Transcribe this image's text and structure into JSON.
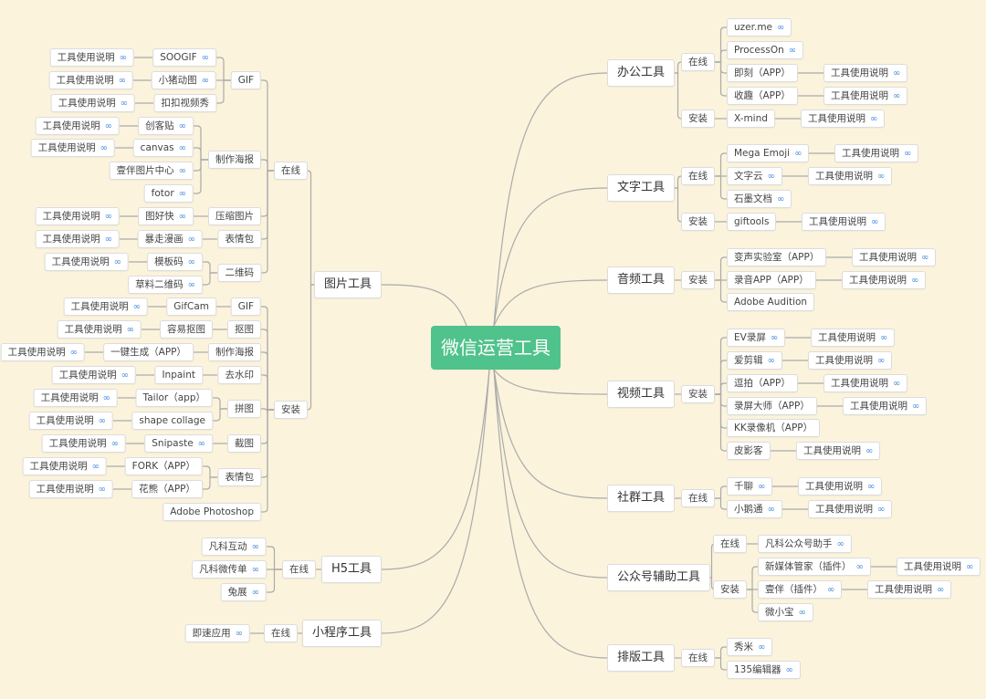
{
  "root": {
    "label": "微信运营工具"
  },
  "colors": {
    "background": "#fbf3dc",
    "root": "#50c28b",
    "link_icon": "#4a90e2",
    "connector": "#aaaaaa"
  },
  "link_icon_glyph": "link-icon",
  "left_branches": [
    {
      "label": "图片工具",
      "groups": [
        {
          "label": "在线",
          "categories": [
            {
              "label": "GIF",
              "items": [
                {
                  "label": "SOOGIF",
                  "link": true,
                  "doc": "工具使用说明"
                },
                {
                  "label": "小猪动图",
                  "link": true,
                  "doc": "工具使用说明"
                },
                {
                  "label": "扣扣视频秀",
                  "link": false,
                  "doc": "工具使用说明"
                }
              ]
            },
            {
              "label": "制作海报",
              "items": [
                {
                  "label": "创客贴",
                  "link": true,
                  "doc": "工具使用说明"
                },
                {
                  "label": "canvas",
                  "link": true,
                  "doc": "工具使用说明"
                },
                {
                  "label": "壹伴图片中心",
                  "link": true
                },
                {
                  "label": "fotor",
                  "link": true
                }
              ]
            },
            {
              "label": "压缩图片",
              "items": [
                {
                  "label": "图好快",
                  "link": true,
                  "doc": "工具使用说明"
                }
              ]
            },
            {
              "label": "表情包",
              "items": [
                {
                  "label": "暴走漫画",
                  "link": true,
                  "doc": "工具使用说明"
                }
              ]
            },
            {
              "label": "二维码",
              "items": [
                {
                  "label": "模板码",
                  "link": true,
                  "doc": "工具使用说明"
                },
                {
                  "label": "草料二维码",
                  "link": true
                }
              ]
            }
          ]
        },
        {
          "label": "安装",
          "categories": [
            {
              "label": "GIF",
              "items": [
                {
                  "label": "GifCam",
                  "link": false,
                  "doc": "工具使用说明"
                }
              ]
            },
            {
              "label": "抠图",
              "items": [
                {
                  "label": "容易抠图",
                  "link": false,
                  "doc": "工具使用说明"
                }
              ]
            },
            {
              "label": "制作海报",
              "items": [
                {
                  "label": "一键生成（APP）",
                  "link": false,
                  "doc": "工具使用说明"
                }
              ]
            },
            {
              "label": "去水印",
              "items": [
                {
                  "label": "Inpaint",
                  "link": false,
                  "doc": "工具使用说明"
                }
              ]
            },
            {
              "label": "拼图",
              "items": [
                {
                  "label": "Tailor（app）",
                  "link": false,
                  "doc": "工具使用说明"
                },
                {
                  "label": "shape collage",
                  "link": false,
                  "doc": "工具使用说明"
                }
              ]
            },
            {
              "label": "截图",
              "items": [
                {
                  "label": "Snipaste",
                  "link": true,
                  "doc": "工具使用说明"
                }
              ]
            },
            {
              "label": "表情包",
              "items": [
                {
                  "label": "FORK（APP）",
                  "link": false,
                  "doc": "工具使用说明"
                },
                {
                  "label": "花熊（APP）",
                  "link": false,
                  "doc": "工具使用说明"
                }
              ]
            },
            {
              "label": "Adobe Photoshop",
              "items": []
            }
          ]
        }
      ]
    },
    {
      "label": "H5工具",
      "groups": [
        {
          "label": "在线",
          "items": [
            {
              "label": "凡科互动",
              "link": true
            },
            {
              "label": "凡科微传单",
              "link": true
            },
            {
              "label": "兔展",
              "link": true
            }
          ]
        }
      ]
    },
    {
      "label": "小程序工具",
      "groups": [
        {
          "label": "在线",
          "items": [
            {
              "label": "即速应用",
              "link": true
            }
          ]
        }
      ]
    }
  ],
  "right_branches": [
    {
      "label": "办公工具",
      "groups": [
        {
          "label": "在线",
          "items": [
            {
              "label": "uzer.me",
              "link": true
            },
            {
              "label": "ProcessOn",
              "link": true
            },
            {
              "label": "即刻（APP）",
              "link": false,
              "doc": "工具使用说明"
            },
            {
              "label": "收趣（APP）",
              "link": false,
              "doc": "工具使用说明"
            }
          ]
        },
        {
          "label": "安装",
          "items": [
            {
              "label": "X-mind",
              "link": false,
              "doc": "工具使用说明"
            }
          ]
        }
      ]
    },
    {
      "label": "文字工具",
      "groups": [
        {
          "label": "在线",
          "items": [
            {
              "label": "Mega Emoji",
              "link": true,
              "doc": "工具使用说明"
            },
            {
              "label": "文字云",
              "link": true,
              "doc": "工具使用说明"
            },
            {
              "label": "石墨文档",
              "link": true
            }
          ]
        },
        {
          "label": "安装",
          "items": [
            {
              "label": "giftools",
              "link": false,
              "doc": "工具使用说明"
            }
          ]
        }
      ]
    },
    {
      "label": "音频工具",
      "groups": [
        {
          "label": "安装",
          "items": [
            {
              "label": "变声实验室（APP）",
              "link": false,
              "doc": "工具使用说明"
            },
            {
              "label": "录音APP（APP）",
              "link": false,
              "doc": "工具使用说明"
            },
            {
              "label": "Adobe Audition",
              "link": false
            }
          ]
        }
      ]
    },
    {
      "label": "视频工具",
      "groups": [
        {
          "label": "安装",
          "items": [
            {
              "label": "EV录屏",
              "link": true,
              "doc": "工具使用说明"
            },
            {
              "label": "爱剪辑",
              "link": true,
              "doc": "工具使用说明"
            },
            {
              "label": "逗拍（APP）",
              "link": false,
              "doc": "工具使用说明"
            },
            {
              "label": "录屏大师（APP）",
              "link": false,
              "doc": "工具使用说明"
            },
            {
              "label": "KK录像机（APP）",
              "link": false
            },
            {
              "label": "皮影客",
              "link": false,
              "doc": "工具使用说明"
            }
          ]
        }
      ]
    },
    {
      "label": "社群工具",
      "groups": [
        {
          "label": "在线",
          "items": [
            {
              "label": "千聊",
              "link": true,
              "doc": "工具使用说明"
            },
            {
              "label": "小鹅通",
              "link": true,
              "doc": "工具使用说明"
            }
          ]
        }
      ]
    },
    {
      "label": "公众号辅助工具",
      "groups": [
        {
          "label": "在线",
          "items": [
            {
              "label": "凡科公众号助手",
              "link": true
            }
          ]
        },
        {
          "label": "安装",
          "items": [
            {
              "label": "新媒体管家（插件）",
              "link": true,
              "doc": "工具使用说明"
            },
            {
              "label": "壹伴（插件）",
              "link": true,
              "doc": "工具使用说明"
            },
            {
              "label": "微小宝",
              "link": true
            }
          ]
        }
      ]
    },
    {
      "label": "排版工具",
      "groups": [
        {
          "label": "在线",
          "items": [
            {
              "label": "秀米",
              "link": true
            },
            {
              "label": "135编辑器",
              "link": true
            }
          ]
        }
      ]
    }
  ]
}
